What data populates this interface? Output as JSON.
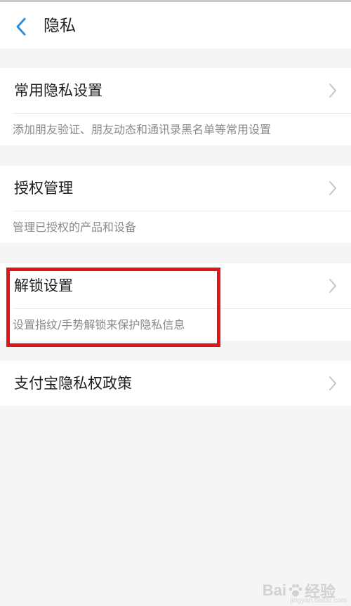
{
  "header": {
    "title": "隐私",
    "back_icon": "chevron-left-icon",
    "accent_color": "#2f8fd8"
  },
  "sections": [
    {
      "title": "常用隐私设置",
      "description": "添加朋友验证、朋友动态和通讯录黑名单等常用设置",
      "chevron_icon": "chevron-right-icon"
    },
    {
      "title": "授权管理",
      "description": "管理已授权的产品和设备",
      "chevron_icon": "chevron-right-icon"
    },
    {
      "title": "解锁设置",
      "description": "设置指纹/手势解锁来保护隐私信息",
      "chevron_icon": "chevron-right-icon",
      "highlighted": true
    },
    {
      "title": "支付宝隐私权政策",
      "chevron_icon": "chevron-right-icon"
    }
  ],
  "highlight_color": "#e0151c",
  "watermark": {
    "brand_left": "Bai",
    "brand_right": "经验",
    "url": "jingyan.baidu.com",
    "icon": "paw-icon"
  }
}
